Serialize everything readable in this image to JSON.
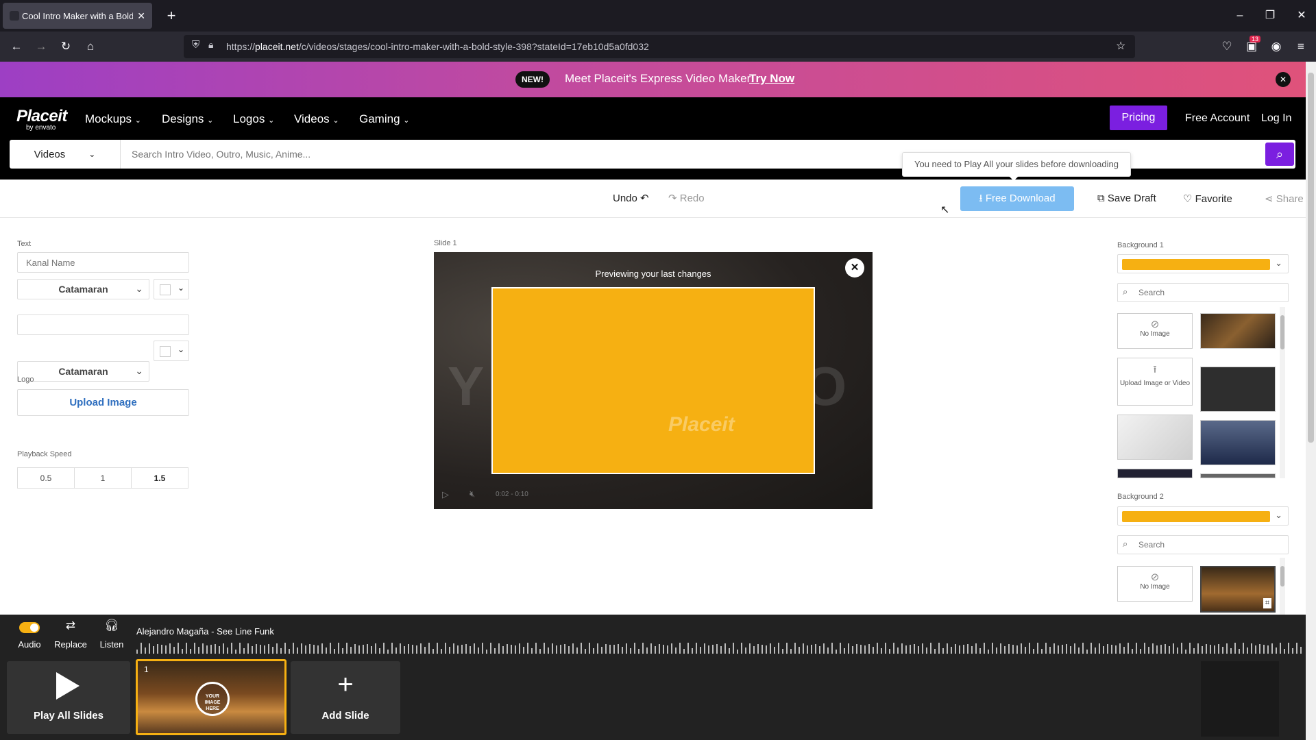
{
  "browser": {
    "tab_title": "Cool Intro Maker with a Bold St",
    "url_prefix": "https://",
    "url_domain": "placeit.net",
    "url_path": "/c/videos/stages/cool-intro-maker-with-a-bold-style-398?stateId=17eb10d5a0fd032",
    "extension_badge": "13"
  },
  "promo": {
    "badge": "NEW!",
    "text": "Meet Placeit's Express Video Maker!",
    "link": "Try Now"
  },
  "site": {
    "logo_main": "Placeit",
    "logo_sub": "by envato",
    "menu": [
      "Mockups",
      "Designs",
      "Logos",
      "Videos",
      "Gaming"
    ],
    "pricing": "Pricing",
    "free_account": "Free Account",
    "login": "Log In",
    "search_category": "Videos",
    "search_placeholder": "Search Intro Video, Outro, Music, Anime..."
  },
  "tooltip": "You need to Play All your slides before downloading",
  "toolbar": {
    "undo": "Undo",
    "redo": "Redo",
    "free_download": "Free Download",
    "save_draft": "Save Draft",
    "favorite": "Favorite",
    "share": "Share"
  },
  "left_panel": {
    "text_label": "Text",
    "field1_placeholder": "Kanal Name",
    "field2_value": "",
    "font1": "Catamaran",
    "font2": "Catamaran",
    "logo_label": "Logo",
    "upload_button": "Upload Image",
    "playback_label": "Playback Speed",
    "speeds": [
      "0.5",
      "1",
      "1.5"
    ],
    "selected_speed": "1.5"
  },
  "preview": {
    "slide_label": "Slide 1",
    "message": "Previewing your last changes",
    "watermark": "Placeit",
    "time": "0:02 - 0:10",
    "background_color": "#f6b012"
  },
  "right_panel": {
    "bg1_label": "Background 1",
    "bg2_label": "Background 2",
    "search_placeholder": "Search",
    "no_image": "No Image",
    "upload_media": "Upload Image or Video",
    "selected_color": "#f6b012"
  },
  "bottom": {
    "audio": "Audio",
    "replace": "Replace",
    "listen": "Listen",
    "track": "Alejandro Magaña - See Line Funk",
    "play_all": "Play All Slides",
    "slide_number": "1",
    "slide_thumb_text": "YOUR IMAGE HERE",
    "add_slide": "Add Slide"
  }
}
